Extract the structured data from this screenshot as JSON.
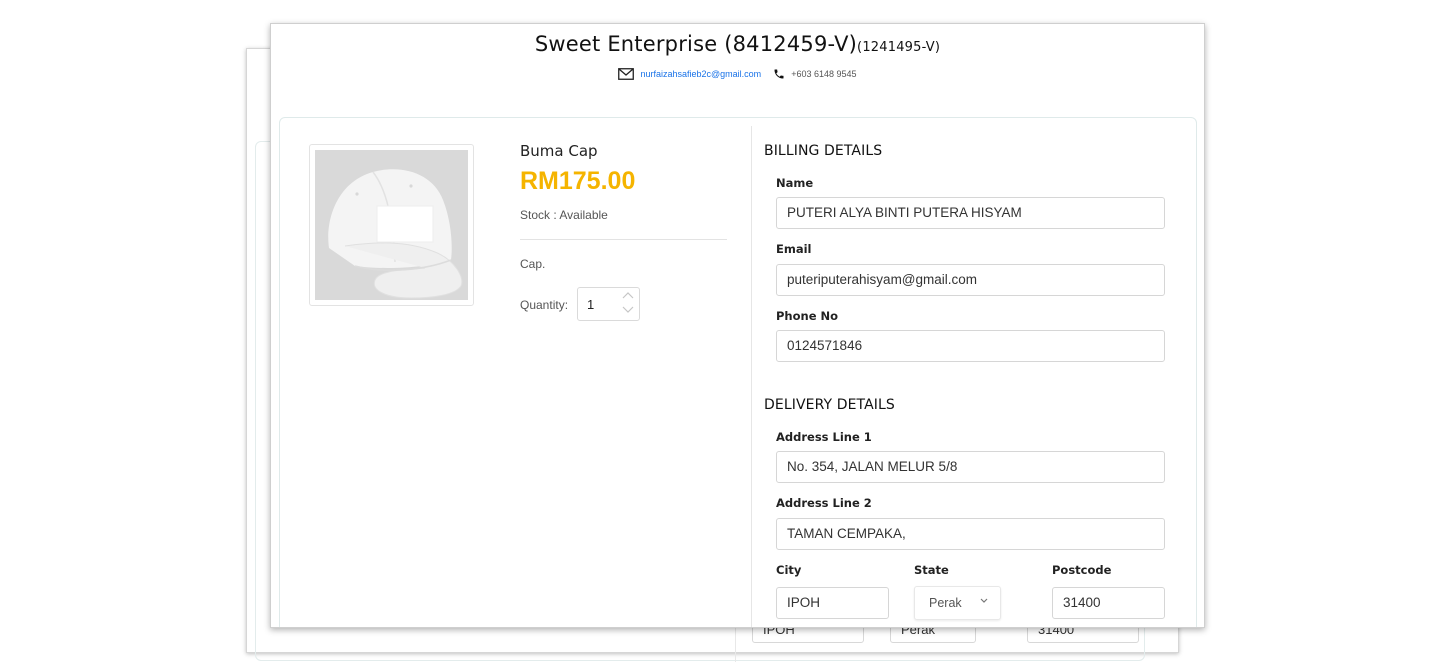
{
  "store": {
    "name": "Sweet Enterprise (8412459-V)",
    "registration": "(1241495-V)",
    "email": "nurfaizahsafieb2c@gmail.com",
    "phone": "+603 6148 9545"
  },
  "product": {
    "name": "Buma Cap",
    "price": "RM175.00",
    "stock": "Stock : Available",
    "description": "Cap.",
    "quantity_label": "Quantity:",
    "quantity": "1",
    "image_icon": "white-cap-photo"
  },
  "billing": {
    "heading": "BILLING DETAILS",
    "name_label": "Name",
    "name_value": "PUTERI ALYA BINTI PUTERA HISYAM",
    "email_label": "Email",
    "email_value": "puteriputerahisyam@gmail.com",
    "phone_label": "Phone No",
    "phone_value": "0124571846"
  },
  "delivery": {
    "heading": "DELIVERY DETAILS",
    "address1_label": "Address Line 1",
    "address1_value": "No. 354, JALAN MELUR 5/8",
    "address2_label": "Address Line 2",
    "address2_value": "TAMAN CEMPAKA,",
    "city_label": "City",
    "city_value": "IPOH",
    "state_label": "State",
    "state_value": "Perak",
    "postcode_label": "Postcode",
    "postcode_value": "31400"
  },
  "back_window": {
    "city_value": "IPOH",
    "state_value": "Perak",
    "postcode_value": "31400"
  },
  "colors": {
    "price": "#f5b400",
    "email_link": "#1a73e8"
  }
}
